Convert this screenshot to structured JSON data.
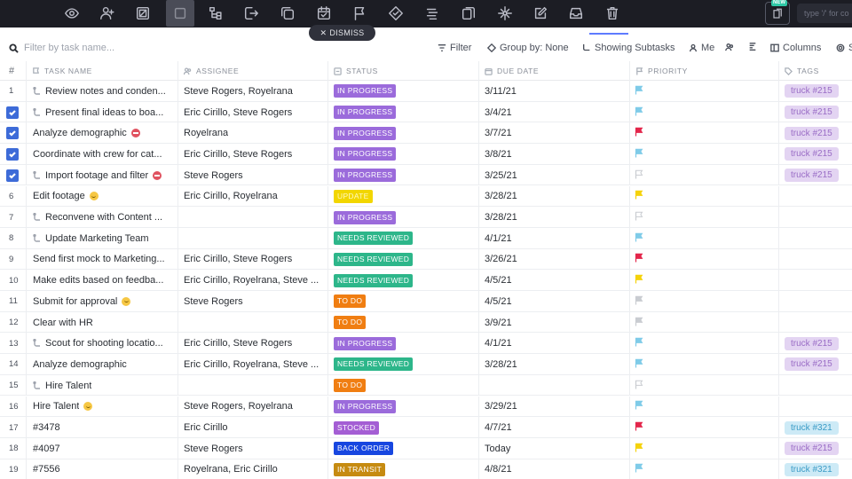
{
  "toolbar": {
    "icons": [
      "eye-icon",
      "user-add-icon",
      "tag-box-icon",
      "square-icon",
      "hierarchy-icon",
      "move-icon",
      "duplicate-icon",
      "calendar-icon",
      "flag-icon",
      "status-icon",
      "list-icon",
      "copy-icon",
      "connect-icon",
      "edit-icon",
      "inbox-icon",
      "trash-icon"
    ],
    "new_badge": "NEW",
    "command_placeholder": "type '/' for co"
  },
  "dismiss_label": "DISMISS",
  "filterbar": {
    "search_placeholder": "Filter by task name...",
    "filter_label": "Filter",
    "group_by_label": "Group by: None",
    "subtasks_label": "Showing Subtasks",
    "me_label": "Me",
    "columns_label": "Columns",
    "extra_label": "S"
  },
  "columns": {
    "num": "#",
    "task_name": "TASK NAME",
    "assignee": "ASSIGNEE",
    "status": "STATUS",
    "due_date": "DUE DATE",
    "priority": "PRIORITY",
    "tags": "TAGS"
  },
  "colors": {
    "in_progress": "#9b6bdb",
    "update": "#f2d600",
    "needs_reviewed": "#2db68a",
    "to_do": "#f07e12",
    "stocked": "#a45ed4",
    "back_order": "#1746e0",
    "in_transit": "#c68b11",
    "flag_blue": "#7fcbe8",
    "flag_red": "#e3264b",
    "flag_yellow": "#f5d20a",
    "flag_grey": "#c9ccd1",
    "tag_purple_bg": "#e3d4f2",
    "tag_purple_fg": "#9a6dc6",
    "tag_blue_bg": "#cdeaf6",
    "tag_blue_fg": "#3a9bc6",
    "checkbox": "#3d6bd8"
  },
  "rows": [
    {
      "num": "1",
      "checked": false,
      "subtask": true,
      "name": "Review notes and conden...",
      "emoji": "",
      "assignee": "Steve Rogers, Royelrana",
      "status": "IN PROGRESS",
      "status_key": "in_progress",
      "date": "3/11/21",
      "flag": "blue",
      "flag_outline": false,
      "tag": "truck #215",
      "tag_style": "purple"
    },
    {
      "num": "2",
      "checked": true,
      "subtask": true,
      "name": "Present final ideas to boa...",
      "emoji": "",
      "assignee": "Eric Cirillo, Steve Rogers",
      "status": "IN PROGRESS",
      "status_key": "in_progress",
      "date": "3/4/21",
      "flag": "blue",
      "flag_outline": false,
      "tag": "truck #215",
      "tag_style": "purple"
    },
    {
      "num": "3",
      "checked": true,
      "subtask": false,
      "name": "Analyze demographic",
      "emoji": "red",
      "assignee": "Royelrana",
      "status": "IN PROGRESS",
      "status_key": "in_progress",
      "date": "3/7/21",
      "flag": "red",
      "flag_outline": false,
      "tag": "truck #215",
      "tag_style": "purple"
    },
    {
      "num": "4",
      "checked": true,
      "subtask": false,
      "name": "Coordinate with crew for cat...",
      "emoji": "",
      "assignee": "Eric Cirillo, Steve Rogers",
      "status": "IN PROGRESS",
      "status_key": "in_progress",
      "date": "3/8/21",
      "flag": "blue",
      "flag_outline": false,
      "tag": "truck #215",
      "tag_style": "purple"
    },
    {
      "num": "5",
      "checked": true,
      "subtask": true,
      "name": "Import footage and filter",
      "emoji": "red",
      "assignee": "Steve Rogers",
      "status": "IN PROGRESS",
      "status_key": "in_progress",
      "date": "3/25/21",
      "flag": "grey",
      "flag_outline": true,
      "tag": "truck #215",
      "tag_style": "purple"
    },
    {
      "num": "6",
      "checked": false,
      "subtask": false,
      "name": "Edit footage",
      "emoji": "yellow",
      "assignee": "Eric Cirillo, Royelrana",
      "status": "UPDATE",
      "status_key": "update",
      "date": "3/28/21",
      "flag": "yellow",
      "flag_outline": false,
      "tag": "",
      "tag_style": ""
    },
    {
      "num": "7",
      "checked": false,
      "subtask": true,
      "name": "Reconvene with Content ...",
      "emoji": "",
      "assignee": "",
      "status": "IN PROGRESS",
      "status_key": "in_progress",
      "date": "3/28/21",
      "flag": "grey",
      "flag_outline": true,
      "tag": "",
      "tag_style": ""
    },
    {
      "num": "8",
      "checked": false,
      "subtask": true,
      "name": "Update Marketing Team",
      "emoji": "",
      "assignee": "",
      "status": "NEEDS REVIEWED",
      "status_key": "needs_reviewed",
      "date": "4/1/21",
      "flag": "blue",
      "flag_outline": false,
      "tag": "",
      "tag_style": ""
    },
    {
      "num": "9",
      "checked": false,
      "subtask": false,
      "name": "Send first mock to Marketing...",
      "emoji": "",
      "assignee": "Eric Cirillo, Steve Rogers",
      "status": "NEEDS REVIEWED",
      "status_key": "needs_reviewed",
      "date": "3/26/21",
      "flag": "red",
      "flag_outline": false,
      "tag": "",
      "tag_style": ""
    },
    {
      "num": "10",
      "checked": false,
      "subtask": false,
      "name": "Make edits based on feedba...",
      "emoji": "",
      "assignee": "Eric Cirillo, Royelrana, Steve ...",
      "status": "NEEDS REVIEWED",
      "status_key": "needs_reviewed",
      "date": "4/5/21",
      "flag": "yellow",
      "flag_outline": false,
      "tag": "",
      "tag_style": ""
    },
    {
      "num": "11",
      "checked": false,
      "subtask": false,
      "name": "Submit for approval",
      "emoji": "yellow",
      "assignee": "Steve Rogers",
      "status": "TO DO",
      "status_key": "to_do",
      "date": "4/5/21",
      "flag": "grey",
      "flag_outline": false,
      "tag": "",
      "tag_style": ""
    },
    {
      "num": "12",
      "checked": false,
      "subtask": false,
      "name": "Clear with HR",
      "emoji": "",
      "assignee": "",
      "status": "TO DO",
      "status_key": "to_do",
      "date": "3/9/21",
      "flag": "grey",
      "flag_outline": false,
      "tag": "",
      "tag_style": ""
    },
    {
      "num": "13",
      "checked": false,
      "subtask": true,
      "name": "Scout for shooting locatio...",
      "emoji": "",
      "assignee": "Eric Cirillo, Steve Rogers",
      "status": "IN PROGRESS",
      "status_key": "in_progress",
      "date": "4/1/21",
      "flag": "blue",
      "flag_outline": false,
      "tag": "truck #215",
      "tag_style": "purple"
    },
    {
      "num": "14",
      "checked": false,
      "subtask": false,
      "name": "Analyze demographic",
      "emoji": "",
      "assignee": "Eric Cirillo, Royelrana, Steve ...",
      "status": "NEEDS REVIEWED",
      "status_key": "needs_reviewed",
      "date": "3/28/21",
      "flag": "blue",
      "flag_outline": false,
      "tag": "truck #215",
      "tag_style": "purple"
    },
    {
      "num": "15",
      "checked": false,
      "subtask": true,
      "name": "Hire Talent",
      "emoji": "",
      "assignee": "",
      "status": "TO DO",
      "status_key": "to_do",
      "date": "",
      "flag": "grey",
      "flag_outline": true,
      "tag": "",
      "tag_style": ""
    },
    {
      "num": "16",
      "checked": false,
      "subtask": false,
      "name": "Hire Talent",
      "emoji": "yellow",
      "assignee": "Steve Rogers, Royelrana",
      "status": "IN PROGRESS",
      "status_key": "in_progress",
      "date": "3/29/21",
      "flag": "blue",
      "flag_outline": false,
      "tag": "",
      "tag_style": ""
    },
    {
      "num": "17",
      "checked": false,
      "subtask": false,
      "name": "#3478",
      "emoji": "",
      "assignee": "Eric Cirillo",
      "status": "STOCKED",
      "status_key": "stocked",
      "date": "4/7/21",
      "flag": "red",
      "flag_outline": false,
      "tag": "truck #321",
      "tag_style": "blue"
    },
    {
      "num": "18",
      "checked": false,
      "subtask": false,
      "name": "#4097",
      "emoji": "",
      "assignee": "Steve Rogers",
      "status": "BACK ORDER",
      "status_key": "back_order",
      "date": "Today",
      "flag": "yellow",
      "flag_outline": false,
      "tag": "truck #215",
      "tag_style": "purple"
    },
    {
      "num": "19",
      "checked": false,
      "subtask": false,
      "name": "#7556",
      "emoji": "",
      "assignee": "Royelrana, Eric Cirillo",
      "status": "IN TRANSIT",
      "status_key": "in_transit",
      "date": "4/8/21",
      "flag": "blue",
      "flag_outline": false,
      "tag": "truck #321",
      "tag_style": "blue"
    }
  ]
}
